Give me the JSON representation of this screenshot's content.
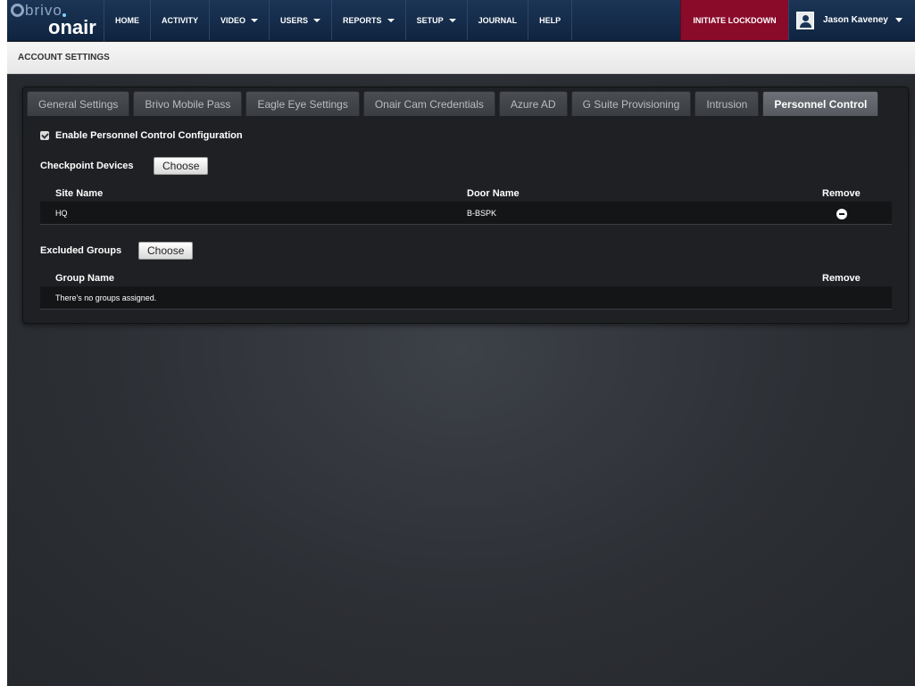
{
  "nav": {
    "logo_top": "brivo",
    "logo_bottom": "onair",
    "items": [
      {
        "label": "HOME",
        "dropdown": false
      },
      {
        "label": "ACTIVITY",
        "dropdown": false
      },
      {
        "label": "VIDEO",
        "dropdown": true
      },
      {
        "label": "USERS",
        "dropdown": true
      },
      {
        "label": "REPORTS",
        "dropdown": true
      },
      {
        "label": "SETUP",
        "dropdown": true
      },
      {
        "label": "JOURNAL",
        "dropdown": false
      },
      {
        "label": "HELP",
        "dropdown": false
      }
    ],
    "lockdown_label": "INITIATE LOCKDOWN",
    "user_name": "Jason Kaveney"
  },
  "page": {
    "title": "ACCOUNT SETTINGS"
  },
  "tabs": [
    {
      "label": "General Settings",
      "active": false
    },
    {
      "label": "Brivo Mobile Pass",
      "active": false
    },
    {
      "label": "Eagle Eye Settings",
      "active": false
    },
    {
      "label": "Onair Cam Credentials",
      "active": false
    },
    {
      "label": "Azure AD",
      "active": false
    },
    {
      "label": "G Suite Provisioning",
      "active": false
    },
    {
      "label": "Intrusion",
      "active": false
    },
    {
      "label": "Personnel Control",
      "active": true
    }
  ],
  "personnel": {
    "enable_label": "Enable Personnel Control Configuration",
    "enabled": true,
    "checkpoint": {
      "label": "Checkpoint Devices",
      "choose_label": "Choose",
      "headers": {
        "site": "Site Name",
        "door": "Door Name",
        "remove": "Remove"
      },
      "rows": [
        {
          "site": "HQ",
          "door": "B-BSPK"
        }
      ]
    },
    "excluded": {
      "label": "Excluded Groups",
      "choose_label": "Choose",
      "headers": {
        "group": "Group Name",
        "remove": "Remove"
      },
      "empty_text": "There's no groups assigned."
    }
  },
  "colors": {
    "nav_bg": "#0f2440",
    "lockdown_bg": "#8a0a2a",
    "panel_bg": "#1e2023"
  }
}
